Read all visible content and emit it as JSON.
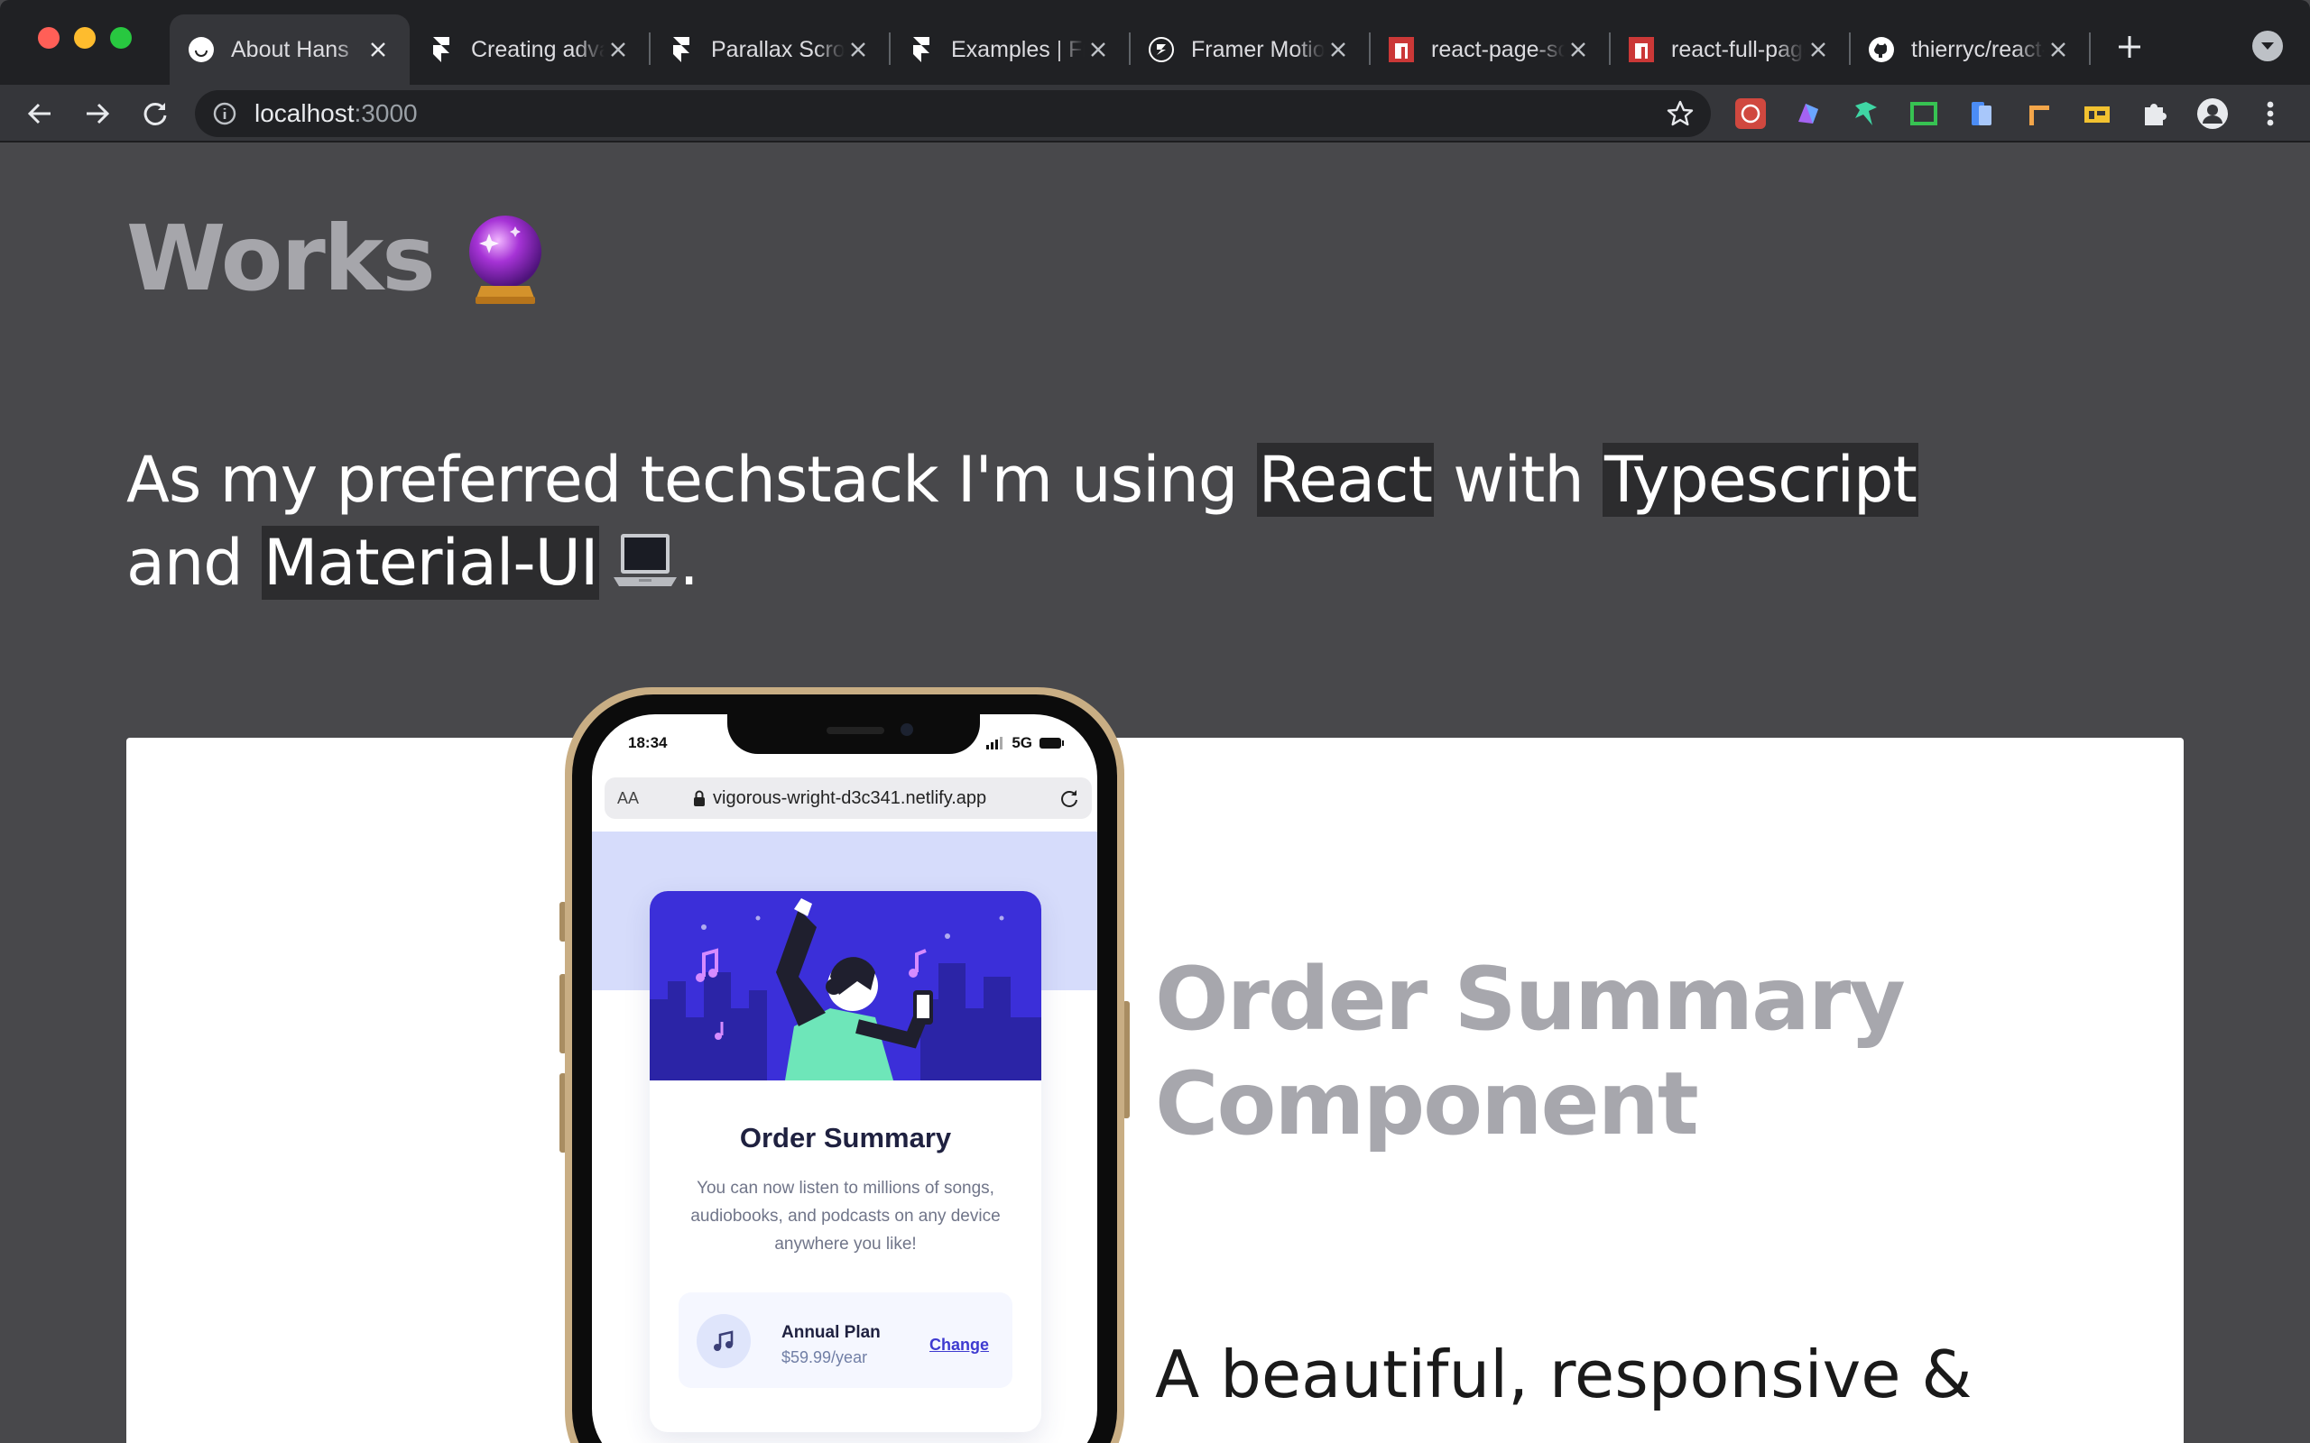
{
  "browser": {
    "tabs": [
      {
        "title": "About Hans",
        "favicon": "about-hans-favicon",
        "active": true
      },
      {
        "title": "Creating advanced",
        "favicon": "framer-favicon"
      },
      {
        "title": "Parallax Scroll",
        "favicon": "framer-favicon"
      },
      {
        "title": "Examples | Framer",
        "favicon": "framer-favicon"
      },
      {
        "title": "Framer Motion",
        "favicon": "framer-motion-favicon"
      },
      {
        "title": "react-page-scroller",
        "favicon": "npm-favicon"
      },
      {
        "title": "react-full-page",
        "favicon": "npm-favicon"
      },
      {
        "title": "thierryc/react-fullpage",
        "favicon": "github-favicon"
      }
    ],
    "url_host": "localhost",
    "url_port": ":3000",
    "extensions": [
      "redux-devtools-icon",
      "prism-icon",
      "dragon-icon",
      "crop-icon",
      "clipboard-icon",
      "ruler-icon",
      "ui-icon",
      "puzzle-icon"
    ]
  },
  "page": {
    "heading": "Works",
    "intro": {
      "part1": "As my preferred techstack I'm using ",
      "tech1": "React",
      "part2": " with ",
      "tech2": "Typescript",
      "part3": "and ",
      "tech3": "Material-UI",
      "part4": "."
    },
    "project": {
      "title_line1": "Order Summary",
      "title_line2": "Component",
      "description": "A beautiful, responsive &"
    }
  },
  "phone": {
    "time": "18:34",
    "network": "5G",
    "aa": "AA",
    "url": "vigorous-wright-d3c341.netlify.app",
    "card": {
      "title": "Order Summary",
      "description": "You can now listen to millions of songs, audiobooks, and podcasts on any device anywhere you like!",
      "plan_name": "Annual Plan",
      "plan_price": "$59.99/year",
      "change_label": "Change"
    }
  },
  "colors": {
    "page_bg": "#48484b",
    "heading": "#a6a6ab",
    "highlight_bg": "#2c2c2e",
    "hero_bg": "#3b2fd9",
    "accent": "#3e3ad0"
  }
}
